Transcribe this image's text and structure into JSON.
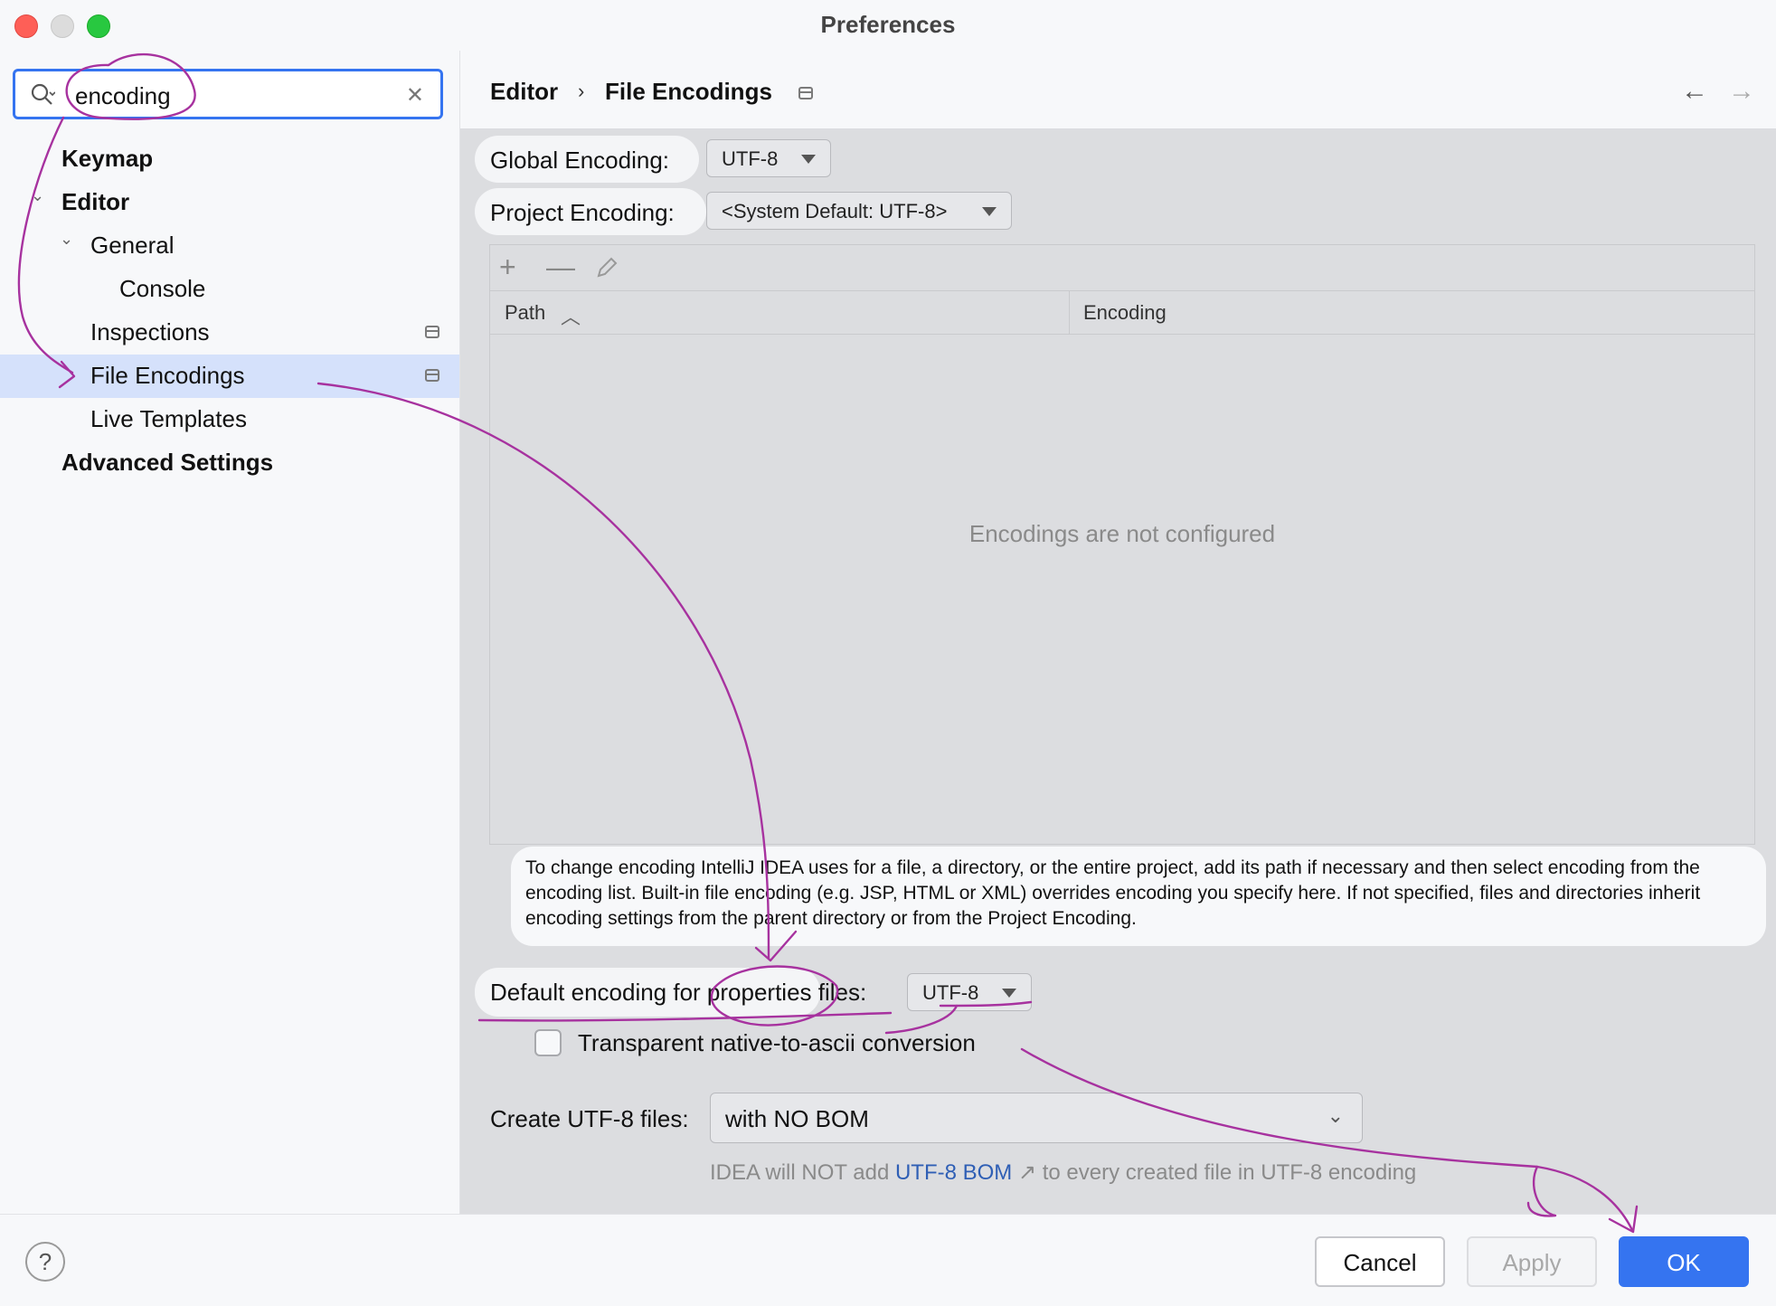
{
  "window": {
    "title": "Preferences"
  },
  "search": {
    "value": "encoding"
  },
  "sidebar": {
    "items": [
      {
        "label": "Keymap"
      },
      {
        "label": "Editor"
      },
      {
        "label": "General"
      },
      {
        "label": "Console"
      },
      {
        "label": "Inspections"
      },
      {
        "label": "File Encodings"
      },
      {
        "label": "Live Templates"
      },
      {
        "label": "Advanced Settings"
      }
    ]
  },
  "breadcrumb": {
    "parent": "Editor",
    "current": "File Encodings"
  },
  "settings": {
    "global_label": "Global Encoding:",
    "global_value": "UTF-8",
    "project_label": "Project Encoding:",
    "project_value": "<System Default: UTF-8>",
    "table": {
      "columns": [
        "Path",
        "Encoding"
      ],
      "empty_text": "Encodings are not configured"
    },
    "hint": "To change encoding IntelliJ IDEA uses for a file, a directory, or the entire project, add its path if necessary and then select encoding from the encoding list. Built-in file encoding (e.g. JSP, HTML or XML) overrides encoding you specify here. If not specified, files and directories inherit encoding settings from the parent directory or from the Project Encoding.",
    "properties_label": "Default encoding for properties files:",
    "properties_value": "UTF-8",
    "transparent_label": "Transparent native-to-ascii conversion",
    "transparent_checked": false,
    "create_label": "Create UTF-8 files:",
    "create_value": "with NO BOM",
    "note_prefix": "IDEA will NOT add",
    "note_link": "UTF-8 BOM",
    "note_arrow": "↗",
    "note_suffix": "to every created file in UTF-8 encoding"
  },
  "footer": {
    "help": "?",
    "cancel": "Cancel",
    "apply": "Apply",
    "ok": "OK"
  },
  "colors": {
    "accent": "#3574f0",
    "annotation": "#a7329f"
  }
}
